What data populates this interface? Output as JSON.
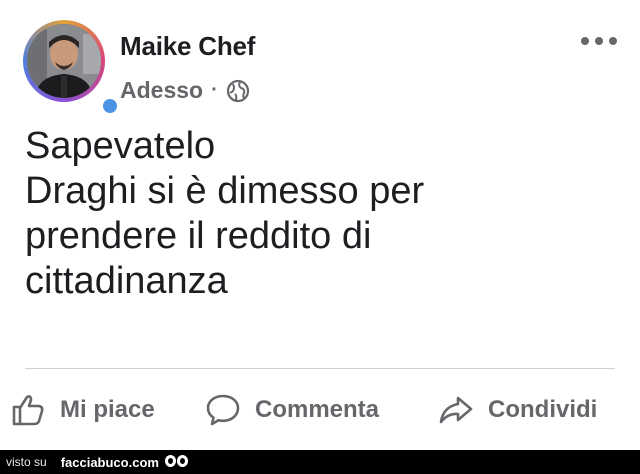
{
  "post": {
    "author": "Maike Chef",
    "time": "Adesso",
    "separator": "·",
    "privacy_icon": "globe-icon",
    "more_icon": "more-options-icon",
    "body_lines": [
      "Sapevatelo",
      "Draghi si è dimesso per",
      "prendere il reddito di",
      "cittadinanza"
    ]
  },
  "actions": {
    "like": {
      "label": "Mi piace",
      "icon": "thumbs-up-icon"
    },
    "comment": {
      "label": "Commenta",
      "icon": "comment-icon"
    },
    "share": {
      "label": "Condividi",
      "icon": "share-icon"
    }
  },
  "footer": {
    "seen_on": "visto su",
    "site": "facciabuco.com"
  },
  "colors": {
    "text_primary": "#1c1e21",
    "text_secondary": "#65676b",
    "divider": "#ced0d4",
    "footer_bg": "#000000"
  }
}
